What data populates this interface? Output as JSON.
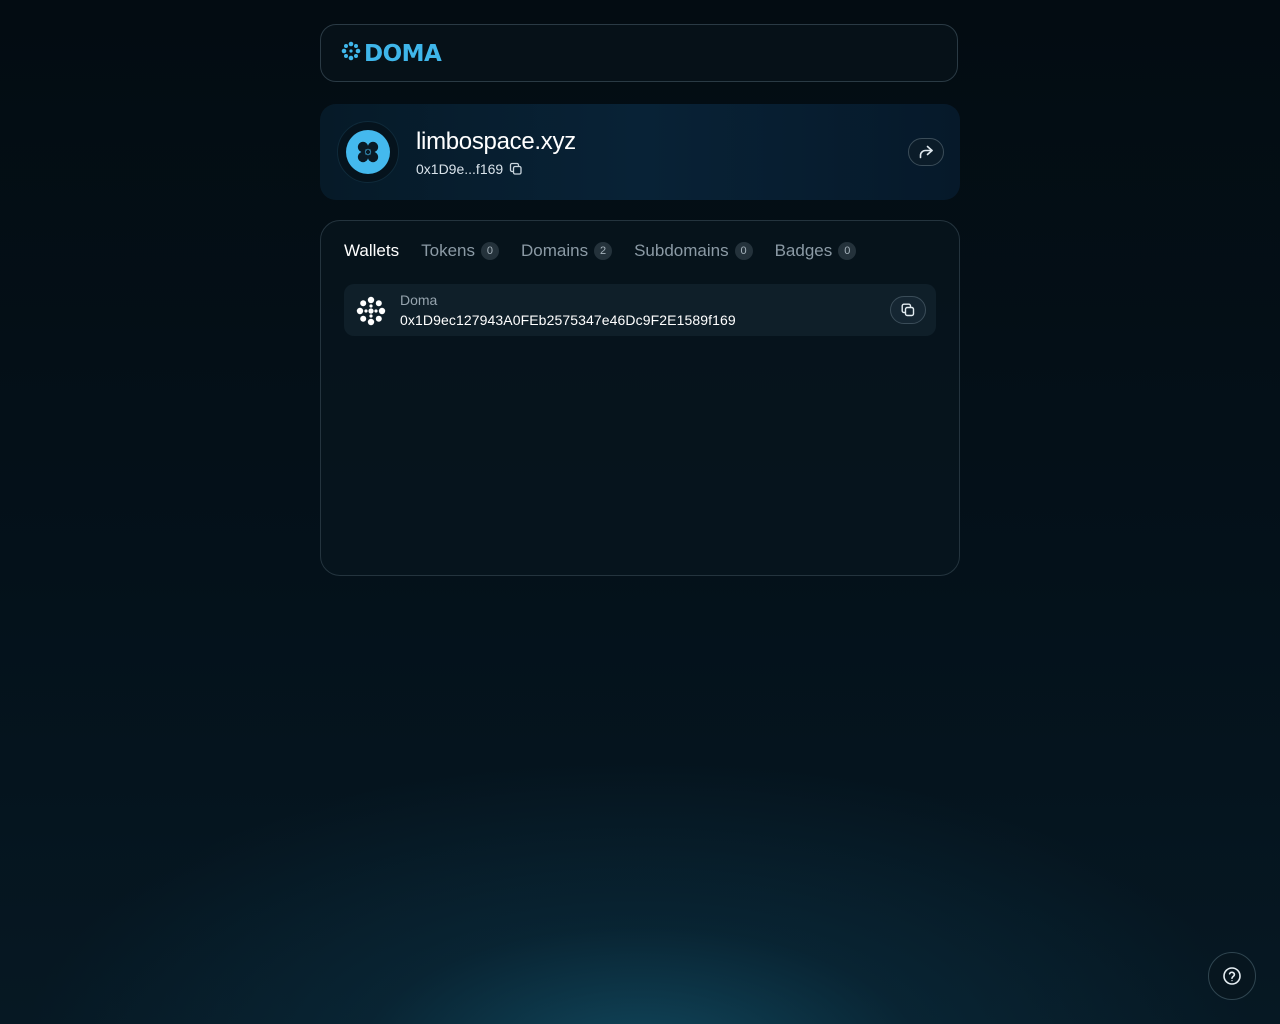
{
  "header": {
    "logo_text": "DOMA",
    "logo_icon": "doma-flower-icon"
  },
  "profile": {
    "domain_name": "limbospace.xyz",
    "short_address": "0x1D9e...f169",
    "copy_icon": "copy-icon",
    "share_icon": "share-icon"
  },
  "tabs": [
    {
      "label": "Wallets",
      "count": null,
      "active": true
    },
    {
      "label": "Tokens",
      "count": "0",
      "active": false
    },
    {
      "label": "Domains",
      "count": "2",
      "active": false
    },
    {
      "label": "Subdomains",
      "count": "0",
      "active": false
    },
    {
      "label": "Badges",
      "count": "0",
      "active": false
    }
  ],
  "wallets": [
    {
      "label": "Doma",
      "address": "0x1D9ec127943A0FEb2575347e46Dc9F2E1589f169",
      "icon": "doma-wallet-icon"
    }
  ],
  "help": {
    "icon": "help-icon"
  },
  "colors": {
    "brand": "#3fb6ea",
    "avatar": "#44b9ee",
    "background": "#04111a"
  }
}
